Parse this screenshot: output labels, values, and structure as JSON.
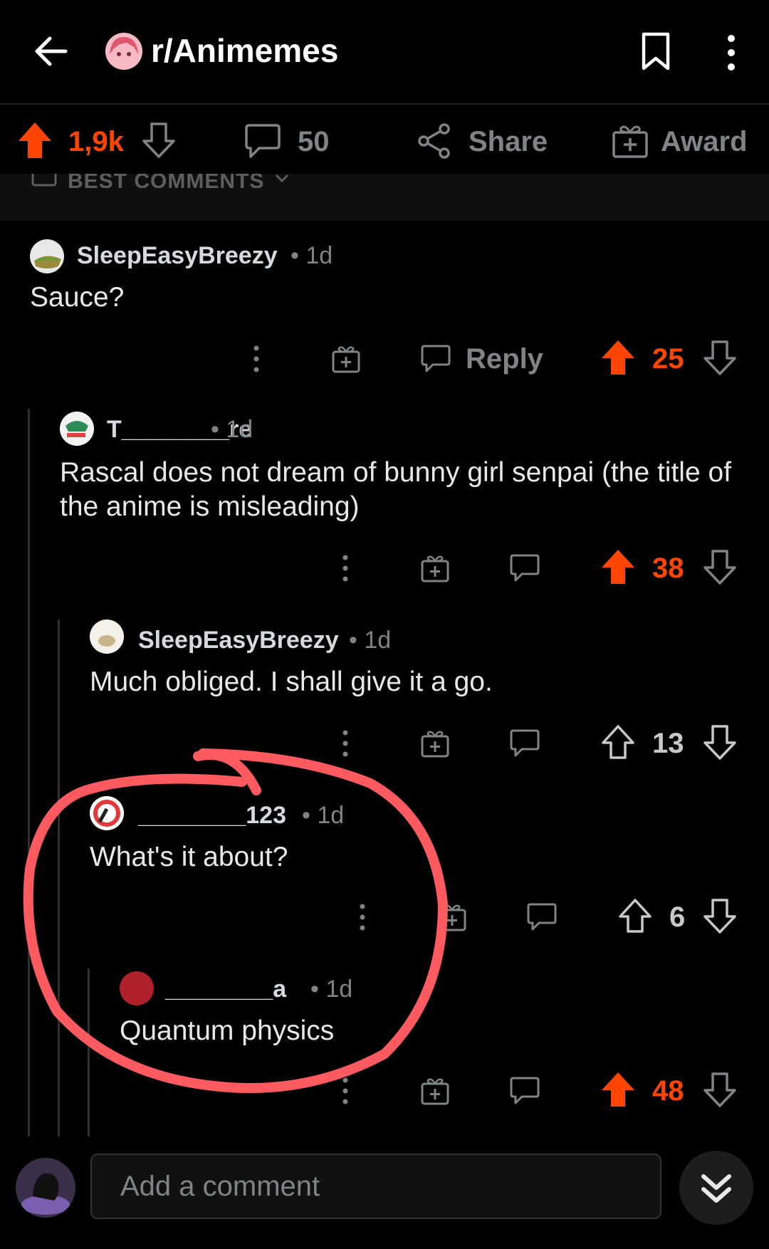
{
  "header": {
    "subreddit": "r/Animemes",
    "back_icon": "back-arrow-icon",
    "bookmark_icon": "bookmark-icon",
    "more_icon": "more-vertical-icon"
  },
  "actions": {
    "upvotes": "1,9k",
    "comments": "50",
    "share_label": "Share",
    "award_label": "Award"
  },
  "sort": {
    "label": "BEST COMMENTS"
  },
  "comments": [
    {
      "author": "SleepEasyBreezy",
      "age": "1d",
      "body": "Sauce?",
      "score": "25",
      "upvoted": true,
      "reply_label": "Reply"
    },
    {
      "author": "T________re",
      "age": "1d",
      "body": "Rascal does not dream of bunny girl senpai (the title of the anime is misleading)",
      "score": "38",
      "upvoted": true
    },
    {
      "author": "SleepEasyBreezy",
      "age": "1d",
      "body": "Much obliged. I shall give it a go.",
      "score": "13",
      "upvoted": false
    },
    {
      "author": "________123",
      "age": "1d",
      "body": "What's it about?",
      "score": "6",
      "upvoted": false
    },
    {
      "author": "________a",
      "age": "1d",
      "body": "Quantum physics",
      "score": "48",
      "upvoted": true
    }
  ],
  "composer": {
    "placeholder": "Add a comment"
  },
  "colors": {
    "upvote": "#ff4500",
    "annotation": "#ff5a5f",
    "background": "#000000"
  }
}
